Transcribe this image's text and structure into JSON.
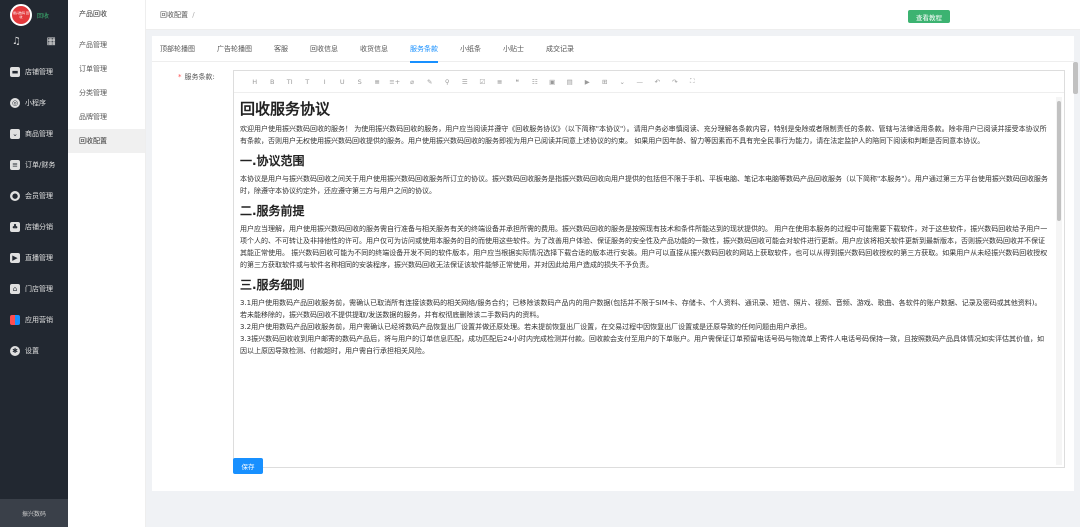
{
  "logo": {
    "badge_text": "振兴数码 回收",
    "side_text": "回收"
  },
  "sidebar": {
    "items": [
      {
        "label": "店铺管理",
        "icon": "store-icon"
      },
      {
        "label": "小程序",
        "icon": "miniprogram-icon"
      },
      {
        "label": "商品管理",
        "icon": "goods-icon"
      },
      {
        "label": "订单/财务",
        "icon": "order-icon"
      },
      {
        "label": "会员管理",
        "icon": "member-icon"
      },
      {
        "label": "店铺分销",
        "icon": "distribution-icon"
      },
      {
        "label": "直播管理",
        "icon": "live-icon"
      },
      {
        "label": "门店管理",
        "icon": "shop-icon"
      },
      {
        "label": "应用营销",
        "icon": "apps-icon"
      },
      {
        "label": "设置",
        "icon": "settings-icon"
      }
    ],
    "footer": "振兴数码"
  },
  "sub_sidebar": {
    "title": "产品回收",
    "items": [
      "产品管理",
      "订单管理",
      "分类管理",
      "品牌管理",
      "回收配置"
    ],
    "active_index": 4
  },
  "topbar": {
    "breadcrumb": "回收配置",
    "breadcrumb_sep": "/",
    "guide_button": "查看教程"
  },
  "tabs": [
    "顶部轮播图",
    "广告轮播图",
    "客服",
    "回收信息",
    "收货信息",
    "服务条款",
    "小纸条",
    "小贴士",
    "成交记录"
  ],
  "active_tab": 5,
  "form": {
    "required_mark": "*",
    "label": "服务条款:",
    "save_label": "保存"
  },
  "toolbar": [
    "H",
    "B",
    "TI",
    "T",
    "I",
    "U",
    "S",
    "≣",
    "≡+",
    "⌀",
    "✎",
    "⚲",
    "☰",
    "☑",
    "≣",
    "❝",
    "☷",
    "▣",
    "▤",
    "▶",
    "⊞",
    "⌄",
    "—",
    "↶",
    "↷",
    "⛶"
  ],
  "content": {
    "title": "回收服务协议",
    "intro": "欢迎用户使用振兴数码回收的服务！ 为使用振兴数码回收的服务，用户应当阅读并遵守《回收服务协议》（以下简称\"本协议\"）。请用户务必审慎阅读、充分理解各条款内容，特别是免除或者限制责任的条款、管辖与法律适用条款。除非用户已阅读并接受本协议所有条款，否则用户无权使用振兴数码回收提供的服务。用户使用振兴数码回收的服务即视为用户已阅读并同意上述协议的约束。 如果用户因年龄、智力等因素而不具有完全民事行为能力，请在法定监护人的陪同下阅读和判断是否同意本协议。",
    "s1_title": "一.协议范围",
    "s1_text": "本协议是用户与振兴数码回收之间关于用户使用振兴数码回收服务所订立的协议。振兴数码回收服务是指振兴数码回收向用户提供的包括但不限于手机、平板电脑、笔记本电脑等数码产品回收服务（以下简称\"本服务\"）。用户通过第三方平台使用振兴数码回收服务时，除遵守本协议约定外，还应遵守第三方与用户之间的协议。",
    "s2_title": "二.服务前提",
    "s2_text": "用户应当理解，用户使用振兴数码回收的服务需自行准备与相关服务有关的终端设备并承担所需的费用。振兴数码回收的服务是按照现有技术和条件所能达到的现状提供的。 用户在使用本服务的过程中可能需要下载软件，对于这些软件，振兴数码回收给予用户一项个人的、不可转让及非排他性的许可。用户仅可为访问或使用本服务的目的而使用这些软件。为了改善用户体验、保证服务的安全性及产品功能的一致性，振兴数码回收可能会对软件进行更新。用户应该将相关软件更新到最新版本，否则振兴数码回收并不保证其能正常使用。 振兴数码回收可能为不同的终端设备开发不同的软件版本，用户应当根据实际情况选择下载合适的版本进行安装。用户可以直接从振兴数码回收的网站上获取软件，也可以从得到振兴数码回收授权的第三方获取。如果用户从未经振兴数码回收授权的第三方获取软件或与软件名称相同的安装程序，振兴数码回收无法保证该软件能够正常使用，并对因此给用户造成的损失不予负责。",
    "s3_title": "三.服务细则",
    "s3_p1": "3.1用户使用数码产品回收服务前，需确认已取消所有连接该数码的相关网络/服务合约；已移除该数码产品内的用户数据(包括并不限于SIM卡、存储卡、个人资料、通讯录、短信、照片、视频、音频、游戏、歌曲、各软件的账户数据、记录及密码或其他资料)。若未能移除的，振兴数码回收不提供提取/发送数据的服务，并有权彻底删除该二手数码内的资料。",
    "s3_p2": "3.2用户使用数码产品回收服务前，用户需确认已经将数码产品恢复出厂设置并做还原处理。若未提前恢复出厂设置，在交易过程中因恢复出厂设置或是还原导致的任何问题由用户承担。",
    "s3_p3": "3.3振兴数码回收收到用户邮寄的数码产品后，将与用户的订单信息匹配，成功匹配后24小时内完成检测并付款。回收款会支付至用户的下单账户。用户需保证订单预留电话号码与物流单上寄件人电话号码保持一致，且按照数码产品具体情况如实评估其价值，如因以上原因导致检测、付款超时，用户需自行承担相关风险。"
  }
}
